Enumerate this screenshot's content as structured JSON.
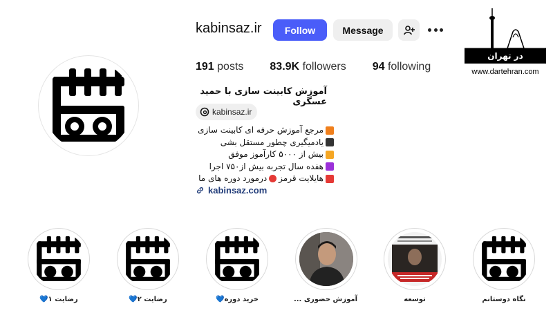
{
  "profile": {
    "username": "kabinsaz.ir",
    "follow_label": "Follow",
    "message_label": "Message",
    "full_name": "آموزش کابینت سازی با حمید عسگری",
    "threads_handle": "kabinsaz.ir",
    "link": "kabinsaz.com"
  },
  "stats": {
    "posts_count": "191",
    "posts_label": "posts",
    "followers_count": "83.9K",
    "followers_label": "followers",
    "following_count": "94",
    "following_label": "following"
  },
  "bio": [
    {
      "text": "مرجع آموزش حرفه ای کابینت سازی",
      "color": "#f07f1c"
    },
    {
      "text": "یادمیگیری چطور مستقل بشی",
      "color": "#333333"
    },
    {
      "text": "بیش از ۵۰۰۰ کارآموز موفق",
      "color": "#f5a623"
    },
    {
      "text": "هفده سال تجربه بیش از۷۵۰ اجرا",
      "color": "#9b30d9"
    },
    {
      "text_before": "هایلایت قرمز",
      "text_after": "درمورد دوره های ما",
      "color": "#e53935"
    }
  ],
  "watermark": {
    "title": "در تهران",
    "url": "www.dartehran.com"
  },
  "highlights": [
    {
      "label": "رضایت ۱",
      "heart": "💙",
      "kind": "logo"
    },
    {
      "label": "رضایت ۲",
      "heart": "💙",
      "kind": "logo"
    },
    {
      "label": "خرید دوره",
      "heart": "💙",
      "kind": "logo"
    },
    {
      "label": "آموزش حضوری ...",
      "heart": "",
      "kind": "person"
    },
    {
      "label": "توسعه",
      "heart": "",
      "kind": "poster"
    },
    {
      "label": "نگاه دوستانم",
      "heart": "",
      "kind": "logo"
    }
  ],
  "icons": {
    "add_user": "person-add-icon",
    "more": "more-dots-icon",
    "threads": "threads-icon",
    "link": "link-icon"
  }
}
